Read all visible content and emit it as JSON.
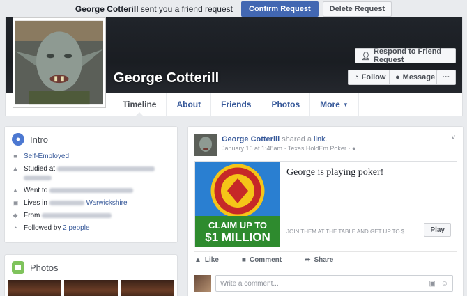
{
  "request_bar": {
    "sender": "George Cotterill",
    "message": "sent you a friend request",
    "confirm_label": "Confirm Request",
    "delete_label": "Delete Request"
  },
  "profile": {
    "name": "George Cotterill",
    "respond_label": "Respond to Friend Request",
    "follow_label": "Follow",
    "message_label": "Message",
    "more_label": "···"
  },
  "tabs": [
    {
      "label": "Timeline"
    },
    {
      "label": "About"
    },
    {
      "label": "Friends"
    },
    {
      "label": "Photos"
    },
    {
      "label": "More"
    }
  ],
  "intro": {
    "title": "Intro",
    "job": "Self-Employed",
    "studied_prefix": "Studied at",
    "went_prefix": "Went to",
    "lives_prefix": "Lives in",
    "lives_region": "Warwickshire",
    "from_prefix": "From",
    "followed_prefix": "Followed by",
    "followed_count": "2 people"
  },
  "photos": {
    "title": "Photos"
  },
  "post": {
    "author": "George Cotterill",
    "action": "shared a",
    "link_word": "link",
    "date": "January 16 at 1:48am",
    "app": "Texas HoldEm Poker",
    "attachment_title": "George is playing poker!",
    "attachment_sub": "JOIN THEM AT THE TABLE AND GET UP TO $...",
    "play_label": "Play",
    "claim_line1": "CLAIM UP TO",
    "claim_line2": "$1 MILLION",
    "like_label": "Like",
    "comment_label": "Comment",
    "share_label": "Share",
    "comment_placeholder": "Write a comment..."
  },
  "colors": {
    "brand": "#4267b2",
    "link": "#365899"
  }
}
